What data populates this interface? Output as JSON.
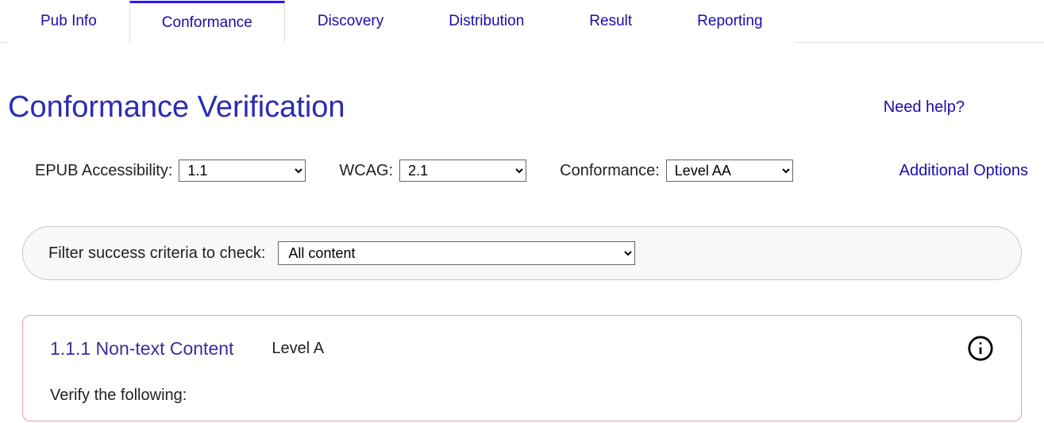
{
  "tabs": [
    {
      "label": "Pub Info"
    },
    {
      "label": "Conformance"
    },
    {
      "label": "Discovery"
    },
    {
      "label": "Distribution"
    },
    {
      "label": "Result"
    },
    {
      "label": "Reporting"
    }
  ],
  "active_tab_index": 1,
  "header": {
    "title": "Conformance Verification",
    "help_link": "Need help?"
  },
  "selectors": {
    "epub_label": "EPUB Accessibility:",
    "epub_value": "1.1",
    "wcag_label": "WCAG:",
    "wcag_value": "2.1",
    "conformance_label": "Conformance:",
    "conformance_value": "Level AA",
    "additional_options": "Additional Options"
  },
  "filter": {
    "label": "Filter success criteria to check:",
    "value": "All content"
  },
  "criterion": {
    "title": "1.1.1 Non-text Content",
    "level": "Level A",
    "body_intro": "Verify the following:"
  }
}
